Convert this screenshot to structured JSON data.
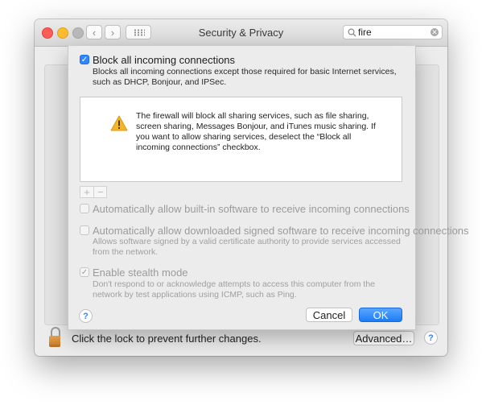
{
  "window": {
    "title": "Security & Privacy"
  },
  "toolbar": {
    "back_glyph": "‹",
    "forward_glyph": "›",
    "search_value": "fire",
    "search_clear_glyph": "✕"
  },
  "icons": {
    "back": "chevron-left-icon",
    "forward": "chevron-right-icon",
    "grid": "show-all-grid-icon",
    "search": "magnifier-icon",
    "clear": "clear-search-icon",
    "lock": "padlock-icon",
    "warning": "warning-triangle-icon",
    "help": "help-question-icon"
  },
  "sheet": {
    "block_all": {
      "label": "Block all incoming connections",
      "checked": true,
      "description": "Blocks all incoming connections except those required for basic Internet services,  such as DHCP, Bonjour, and IPSec."
    },
    "info": {
      "text": "The firewall will block all sharing services, such as file sharing, screen sharing, Messages Bonjour, and iTunes music sharing. If you want to allow sharing services, deselect the “Block all incoming connections” checkbox."
    },
    "add_glyph": "+",
    "remove_glyph": "−",
    "auto_builtin": {
      "label": "Automatically allow built-in software to receive incoming connections",
      "checked": false
    },
    "auto_signed": {
      "label": "Automatically allow downloaded signed software to receive incoming connections",
      "checked": false,
      "description": "Allows software signed by a valid certificate authority to provide services accessed from the network."
    },
    "stealth": {
      "label": "Enable stealth mode",
      "checked": true,
      "description": "Don't respond to or acknowledge attempts to access this computer from the network by test applications using ICMP, such as Ping."
    },
    "help_glyph": "?",
    "cancel_label": "Cancel",
    "ok_label": "OK"
  },
  "bottom": {
    "lock_text": "Click the lock to prevent further changes.",
    "advanced_label": "Advanced…",
    "help_glyph": "?"
  },
  "colors": {
    "accent": "#2f86ff",
    "warning": "#f5b623",
    "lock": "#d88a36"
  }
}
